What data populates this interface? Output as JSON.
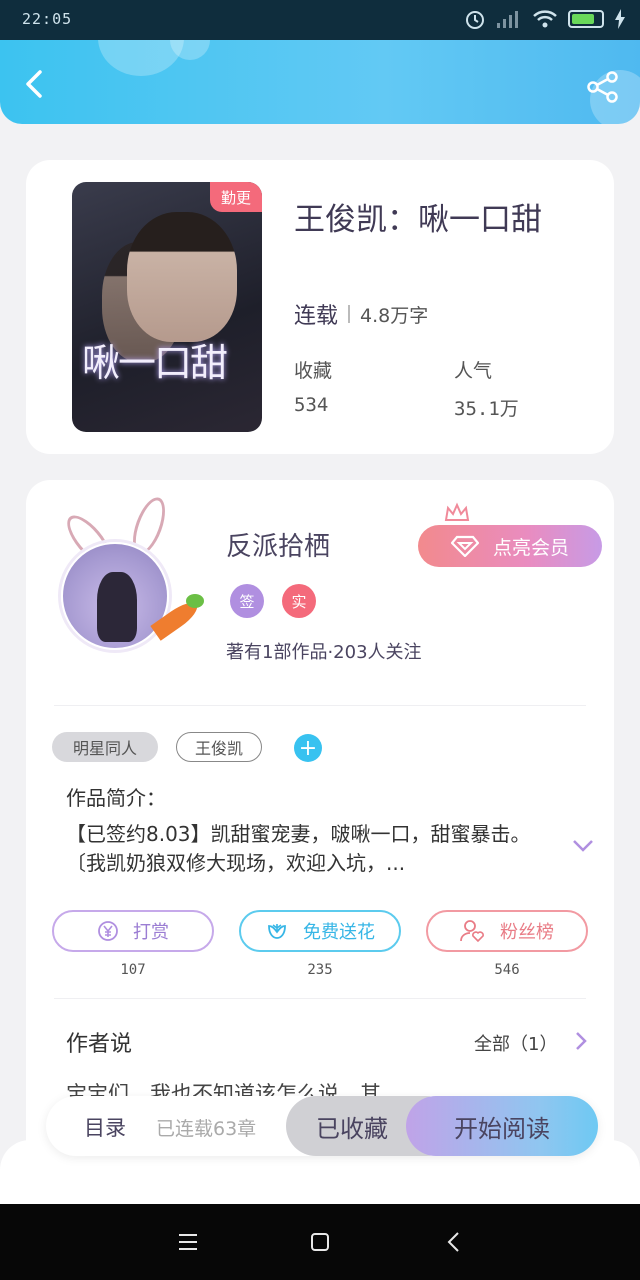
{
  "status_bar": {
    "time": "22:05",
    "battery_level": 0.8
  },
  "book": {
    "title": "王俊凯：啾一口甜",
    "status": "连载",
    "word_count": "4.8万字",
    "update_badge": "勤更",
    "cover_title": "啾一口甜",
    "stats": {
      "favorites_label": "收藏",
      "favorites_value": "534",
      "popularity_label": "人气",
      "popularity_value": "35.1万"
    }
  },
  "author": {
    "name": "反派拾栖",
    "vip_button": "点亮会员",
    "tag_signed": "签",
    "tag_verified": "实",
    "stats_text": "著有1部作品·203人关注"
  },
  "tags": {
    "category": "明星同人",
    "character": "王俊凯",
    "add": "+"
  },
  "intro": {
    "label": "作品简介：",
    "text": "【已签约8.03】凯甜蜜宠妻，啵啾一口，甜蜜暴击。〔我凯奶狼双修大现场，欢迎入坑，..."
  },
  "actions": {
    "reward_label": "打赏",
    "reward_count": "107",
    "flower_label": "免费送花",
    "flower_count": "235",
    "fans_label": "粉丝榜",
    "fans_count": "546"
  },
  "author_says": {
    "title": "作者说",
    "all_label": "全部（1）",
    "preview": "宝宝们，我也不知道该怎么说，其"
  },
  "bottom_bar": {
    "toc_label": "目录",
    "chapters_label": "已连载63章",
    "favorited_label": "已收藏",
    "read_label": "开始阅读"
  },
  "colors": {
    "accent_blue": "#38c2f0",
    "pink": "#f46a7b",
    "purple": "#b08fe0"
  }
}
